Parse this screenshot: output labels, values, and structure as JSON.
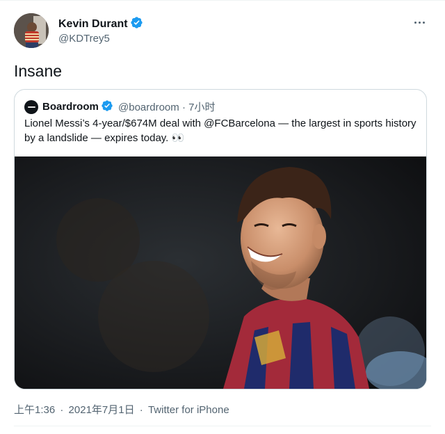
{
  "author": {
    "name": "Kevin Durant",
    "handle": "@KDTrey5",
    "verified_icon": "verified-badge-icon"
  },
  "tweet": {
    "text": "Insane",
    "time": "上午1:36",
    "date": "2021年7月1日",
    "source": "Twitter for iPhone",
    "separator": "·"
  },
  "quoted": {
    "name": "Boardroom",
    "handle": "@boardroom",
    "age": "7小时",
    "separator": "·",
    "text": "Lionel Messi’s 4-year/$674M deal with @FCBarcelona — the largest in sports history by a landslide — expires today. 👀",
    "media_alt": "photo"
  },
  "colors": {
    "verified": "#1d9bf0",
    "secondary_text": "#536471",
    "border": "#cfd9de"
  }
}
